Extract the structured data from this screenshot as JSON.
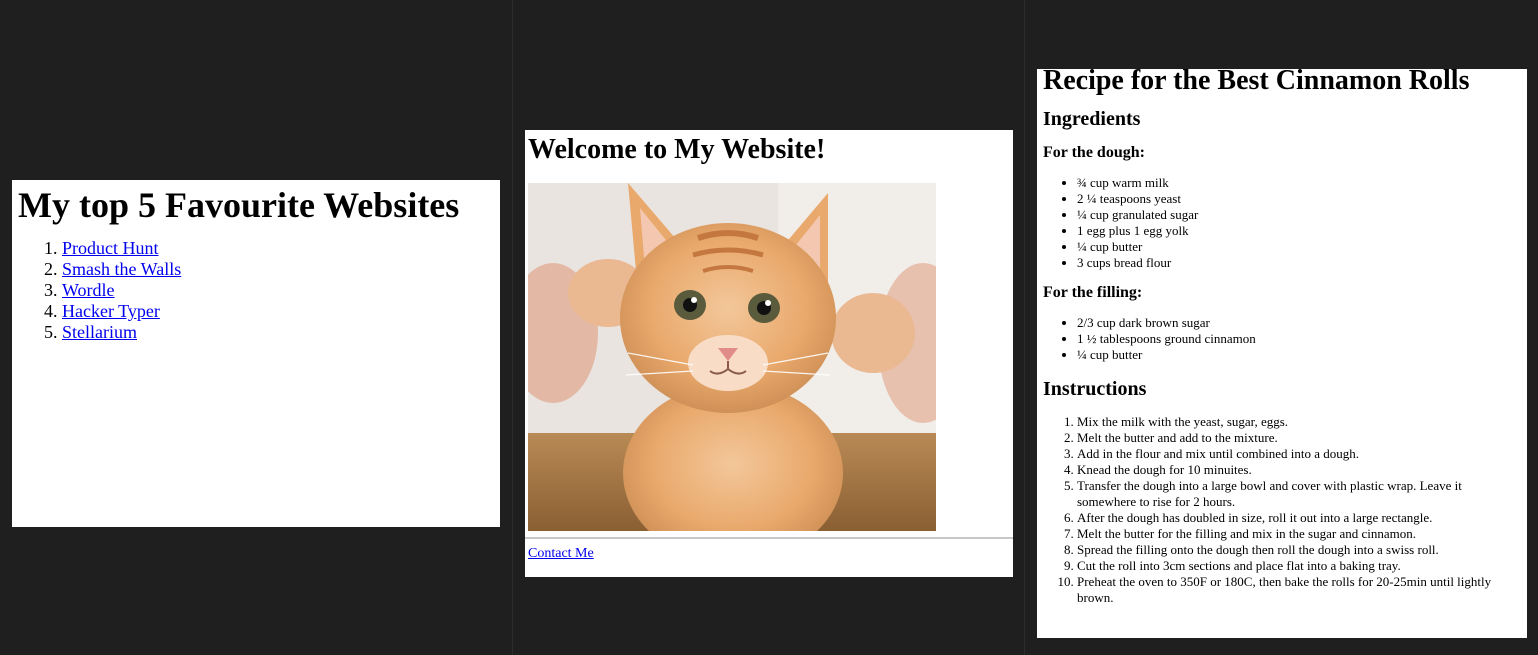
{
  "page1": {
    "title": "My top 5 Favourite Websites",
    "links": [
      "Product Hunt",
      "Smash the Walls",
      "Wordle",
      "Hacker Typer",
      "Stellarium"
    ]
  },
  "page2": {
    "title": "Welcome to My Website!",
    "image": "kitten-photo",
    "contact_link": "Contact Me"
  },
  "page3": {
    "title": "Recipe for the Best Cinnamon Rolls",
    "ingredients_heading": "Ingredients",
    "dough_heading": "For the dough:",
    "dough_items": [
      "¾ cup warm milk",
      "2 ¼ teaspoons yeast",
      "¼ cup granulated sugar",
      "1 egg plus 1 egg yolk",
      "¼ cup butter",
      "3 cups bread flour"
    ],
    "filling_heading": "For the filling:",
    "filling_items": [
      "2/3 cup dark brown sugar",
      "1 ½ tablespoons ground cinnamon",
      "¼ cup butter"
    ],
    "instructions_heading": "Instructions",
    "steps": [
      "Mix the milk with the yeast, sugar, eggs.",
      "Melt the butter and add to the mixture.",
      "Add in the flour and mix until combined into a dough.",
      "Knead the dough for 10 minuites.",
      "Transfer the dough into a large bowl and cover with plastic wrap. Leave it somewhere to rise for 2 hours.",
      "After the dough has doubled in size, roll it out into a large rectangle.",
      "Melt the butter for the filling and mix in the sugar and cinnamon.",
      "Spread the filling onto the dough then roll the dough into a swiss roll.",
      "Cut the roll into 3cm sections and place flat into a baking tray.",
      "Preheat the oven to 350F or 180C, then bake the rolls for 20-25min until lightly brown."
    ]
  }
}
